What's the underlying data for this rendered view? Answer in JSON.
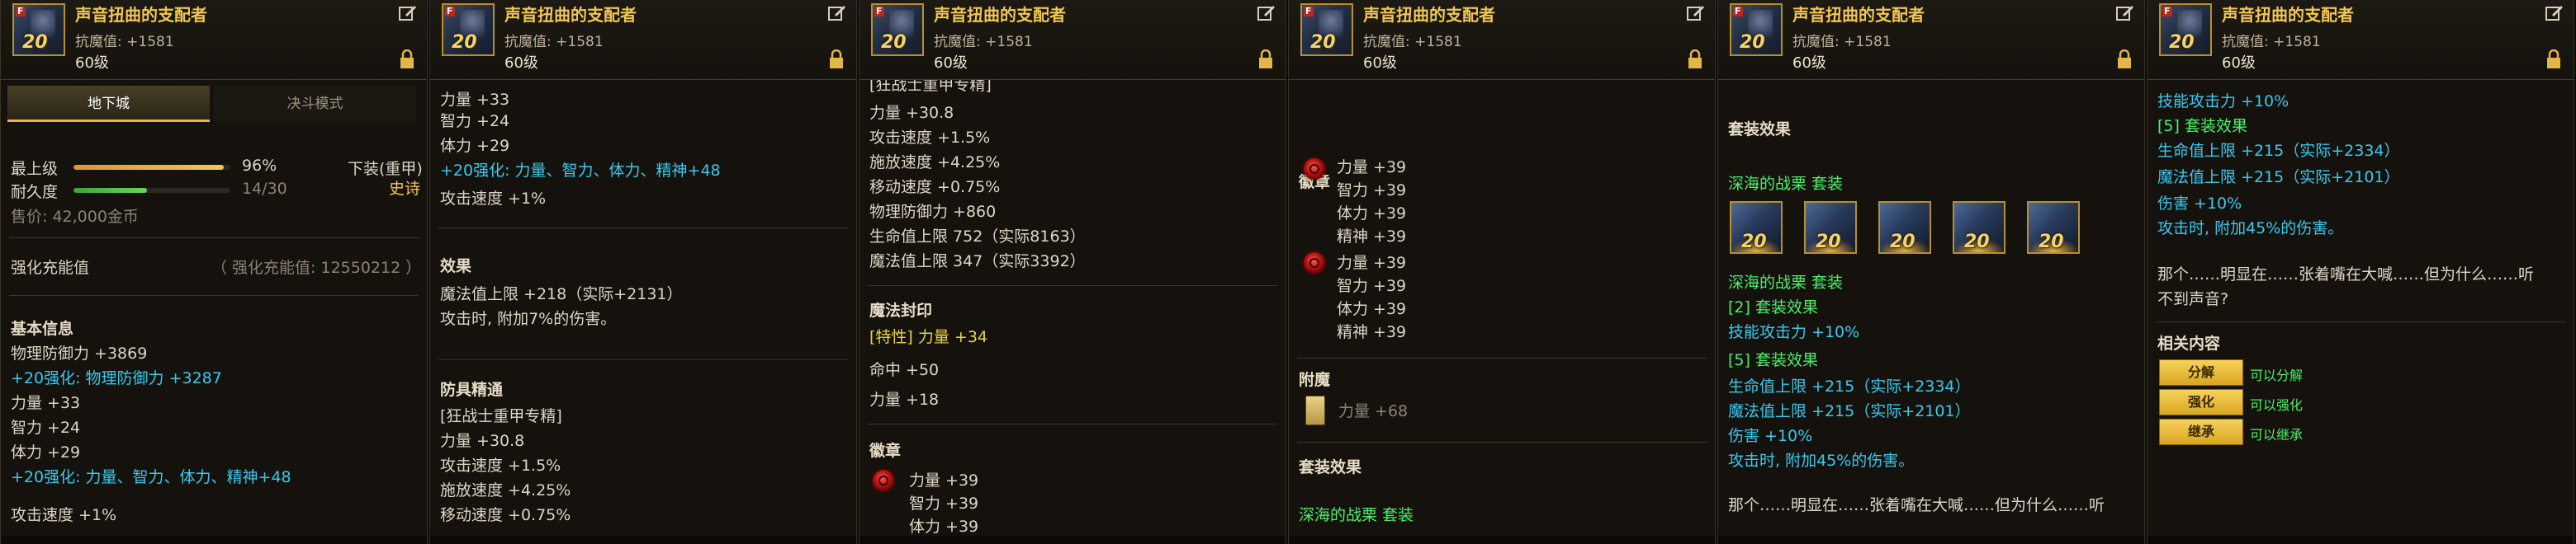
{
  "common": {
    "item_name": "声音扭曲的支配者",
    "resist": "抗魔值: +1581",
    "level": "60级",
    "icon_tag": "F",
    "icon_level": "20"
  },
  "p1": {
    "tab_dungeon": "地下城",
    "tab_duel": "决斗模式",
    "top_grade_label": "最上级",
    "top_grade_pct": "96%",
    "top_grade_fill": 0.96,
    "durability_label": "耐久度",
    "durability_value": "14/30",
    "durability_fill": 0.47,
    "slot": "下装(重甲)",
    "rarity": "史诗",
    "price": "售价: 42,000金币",
    "reinforce_label": "强化充能值",
    "reinforce_value": "（ 强化充能值: 12550212 ）",
    "basic_info": "基本信息",
    "lines": [
      "物理防御力 +3869",
      "+20强化: 物理防御力 +3287",
      "力量 +33",
      "智力 +24",
      "体力 +29",
      "+20强化: 力量、智力、体力、精神+48",
      "攻击速度 +1%"
    ]
  },
  "p2": {
    "top": [
      "力量 +33",
      "智力 +24",
      "体力 +29"
    ],
    "cyan": "+20强化: 力量、智力、体力、精神+48",
    "atk": "攻击速度 +1%",
    "effect_head": "效果",
    "effect": [
      "魔法值上限 +218（实际+2131）",
      "攻击时, 附加7%的伤害。"
    ],
    "mastery_head": "防具精通",
    "mastery": [
      "[狂战士重甲专精]",
      "力量 +30.8",
      "攻击速度 +1.5%",
      "施放速度 +4.25%",
      "移动速度 +0.75%"
    ]
  },
  "p3": {
    "top": [
      "[狂战士重甲专精]",
      "力量 +30.8",
      "攻击速度 +1.5%",
      "施放速度 +4.25%",
      "移动速度 +0.75%",
      "物理防御力 +860",
      "生命值上限 752（实际8163）",
      "魔法值上限 347（实际3392）"
    ],
    "seal_head": "魔法封印",
    "seal": [
      "[特性] 力量 +34",
      "命中 +50",
      "力量 +18"
    ],
    "emblem_head": "徽章",
    "emblem": [
      "力量 +39",
      "智力 +39",
      "体力 +39"
    ]
  },
  "p4": {
    "emblem_head": "徽章",
    "emblem_a": [
      "力量 +39",
      "智力 +39",
      "体力 +39",
      "精神 +39"
    ],
    "emblem_b": [
      "力量 +39",
      "智力 +39",
      "体力 +39",
      "精神 +39"
    ],
    "enchant_head": "附魔",
    "enchant": "力量 +68",
    "set_head": "套装效果",
    "set_name": "深海的战栗 套装"
  },
  "p5": {
    "set_head": "套装效果",
    "set_name": "深海的战栗 套装",
    "set_name2": "深海的战栗 套装",
    "bonus2": "[2] 套装效果",
    "bonus2_line": "技能攻击力 +10%",
    "bonus5": "[5] 套装效果",
    "bonus5_lines": [
      "生命值上限 +215（实际+2334）",
      "魔法值上限 +215（实际+2101）",
      "伤害 +10%",
      "攻击时, 附加45%的伤害。"
    ],
    "flavor": "那个……明显在……张着嘴在大喊……但为什么……听",
    "set_icon_level": "20"
  },
  "p6": {
    "top": "技能攻击力 +10%",
    "bonus5": "[5] 套装效果",
    "bonus5_lines": [
      "生命值上限 +215（实际+2334）",
      "魔法值上限 +215（实际+2101）",
      "伤害 +10%",
      "攻击时, 附加45%的伤害。"
    ],
    "flavor1": "那个……明显在……张着嘴在大喊……但为什么……听",
    "flavor2": "不到声音?",
    "related_head": "相关内容",
    "buttons": [
      {
        "label": "分解",
        "note": "可以分解"
      },
      {
        "label": "强化",
        "note": "可以强化"
      },
      {
        "label": "继承",
        "note": "可以继承"
      }
    ]
  }
}
